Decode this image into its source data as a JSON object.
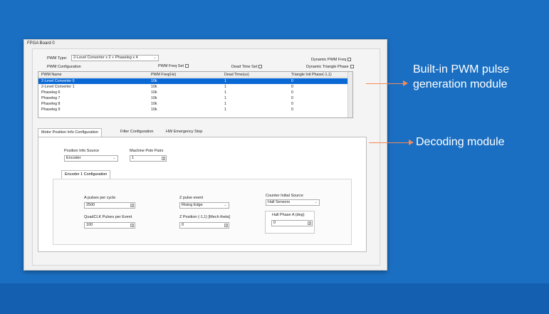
{
  "window": {
    "title": "FPGA Board 0"
  },
  "pwm": {
    "type_label": "PWM Type:",
    "type_value": "2-Level Converter x 2 + Phaseleg x 4",
    "section_label": "PWM Configuration",
    "freq_set_label": "PWM Freq Set",
    "dead_time_set_label": "Dead Time Set",
    "dynamic_freq_label": "Dynamic PWM Freq",
    "dynamic_phase_label": "Dynamic Triangle Phase",
    "columns": [
      "PWM Name",
      "PWM Freq(Hz)",
      "Dead Time(us)",
      "Triangle Init Phase(-1,1)"
    ],
    "rows": [
      [
        "2-Level Converter 0",
        "10k",
        "1",
        "0"
      ],
      [
        "2-Level Converter 1",
        "10k",
        "1",
        "0"
      ],
      [
        "Phaseleg 6",
        "10k",
        "1",
        "0"
      ],
      [
        "Phaseleg 7",
        "10k",
        "1",
        "0"
      ],
      [
        "Phaseleg 8",
        "10k",
        "1",
        "0"
      ],
      [
        "Phaseleg 9",
        "10k",
        "1",
        "0"
      ]
    ]
  },
  "tabs": [
    "Motor Position Info Configuration",
    "Filter Configuration",
    "HW Emergency Stop"
  ],
  "motor": {
    "source_label": "Position Info Source",
    "source_value": "Encoder",
    "pole_pairs_label": "Machine Pole Pairs",
    "pole_pairs_value": "1",
    "subtab": "Encoder 1 Configuration",
    "pulses_label": "A pulses per cycle",
    "pulses_value": "2500",
    "quadclk_label": "QuadCLK Pulses per Event",
    "quadclk_value": "100",
    "zpulse_label": "Z pulse event",
    "zpulse_value": "Rising Edge",
    "zpos_label": "Z Position (-1,1) [Mech theta]",
    "zpos_value": "0",
    "counter_label": "Counter Initial Source",
    "counter_value": "Hall Sensors",
    "hall_label": "Hall Phase A (deg)",
    "hall_value": "0"
  },
  "annotations": {
    "pwm_line1": "Built-in PWM pulse",
    "pwm_line2": "generation module",
    "decoding": "Decoding module"
  },
  "colors": {
    "background": "#1b6fc2",
    "selection": "#0a68d4",
    "arrow": "#f5895a"
  }
}
